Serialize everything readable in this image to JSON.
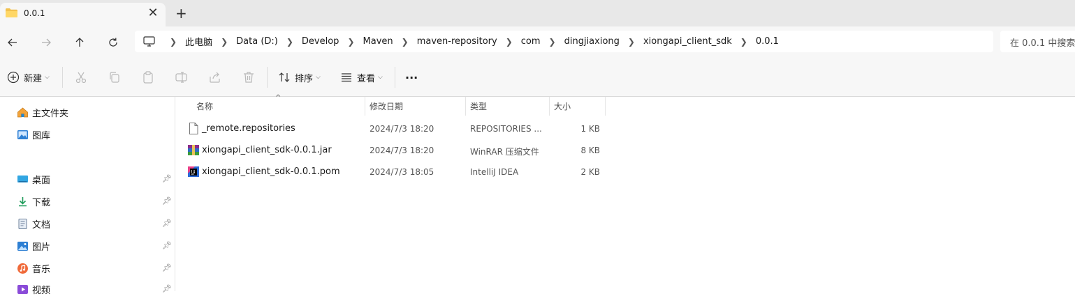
{
  "tab": {
    "title": "0.0.1",
    "close_glyph": "✕",
    "new_tab_glyph": "+",
    "icon": "folder-icon"
  },
  "nav": {
    "back_icon": "arrow-left-icon",
    "forward_icon": "arrow-right-icon",
    "up_icon": "arrow-up-icon",
    "refresh_icon": "refresh-icon"
  },
  "breadcrumb": {
    "root_icon": "computer-icon",
    "items": [
      "此电脑",
      "Data (D:)",
      "Develop",
      "Maven",
      "maven-repository",
      "com",
      "dingjiaxiong",
      "xiongapi_client_sdk",
      "0.0.1"
    ]
  },
  "search": {
    "placeholder": "在 0.0.1 中搜索"
  },
  "toolbar": {
    "new_label": "新建",
    "sort_label": "排序",
    "view_label": "查看",
    "more_label": "···",
    "disabled_icons": [
      "cut-icon",
      "copy-icon",
      "paste-icon",
      "rename-icon",
      "share-icon",
      "delete-icon"
    ]
  },
  "sidebar": {
    "items": [
      {
        "label": "主文件夹",
        "icon": "home-icon",
        "pinned": false
      },
      {
        "label": "图库",
        "icon": "gallery-icon",
        "pinned": false
      },
      {
        "label": "桌面",
        "icon": "desktop-icon",
        "pinned": true
      },
      {
        "label": "下载",
        "icon": "download-icon",
        "pinned": true
      },
      {
        "label": "文档",
        "icon": "document-icon",
        "pinned": true
      },
      {
        "label": "图片",
        "icon": "pictures-icon",
        "pinned": true
      },
      {
        "label": "音乐",
        "icon": "music-icon",
        "pinned": true
      },
      {
        "label": "视频",
        "icon": "video-icon",
        "pinned": true
      }
    ]
  },
  "file_list": {
    "columns": [
      "名称",
      "修改日期",
      "类型",
      "大小"
    ],
    "rows": [
      {
        "name": "_remote.repositories",
        "date": "2024/7/3 18:20",
        "type": "REPOSITORIES ...",
        "size": "1 KB",
        "icon": "blank-file-icon"
      },
      {
        "name": "xiongapi_client_sdk-0.0.1.jar",
        "date": "2024/7/3 18:20",
        "type": "WinRAR 压缩文件",
        "size": "8 KB",
        "icon": "winrar-icon"
      },
      {
        "name": "xiongapi_client_sdk-0.0.1.pom",
        "date": "2024/7/3 18:05",
        "type": "IntelliJ IDEA",
        "size": "2 KB",
        "icon": "intellij-icon"
      }
    ]
  },
  "colors": {
    "folder": "#f2c14e",
    "accent": "#0067c0",
    "disabled": "#b9b9b9"
  }
}
